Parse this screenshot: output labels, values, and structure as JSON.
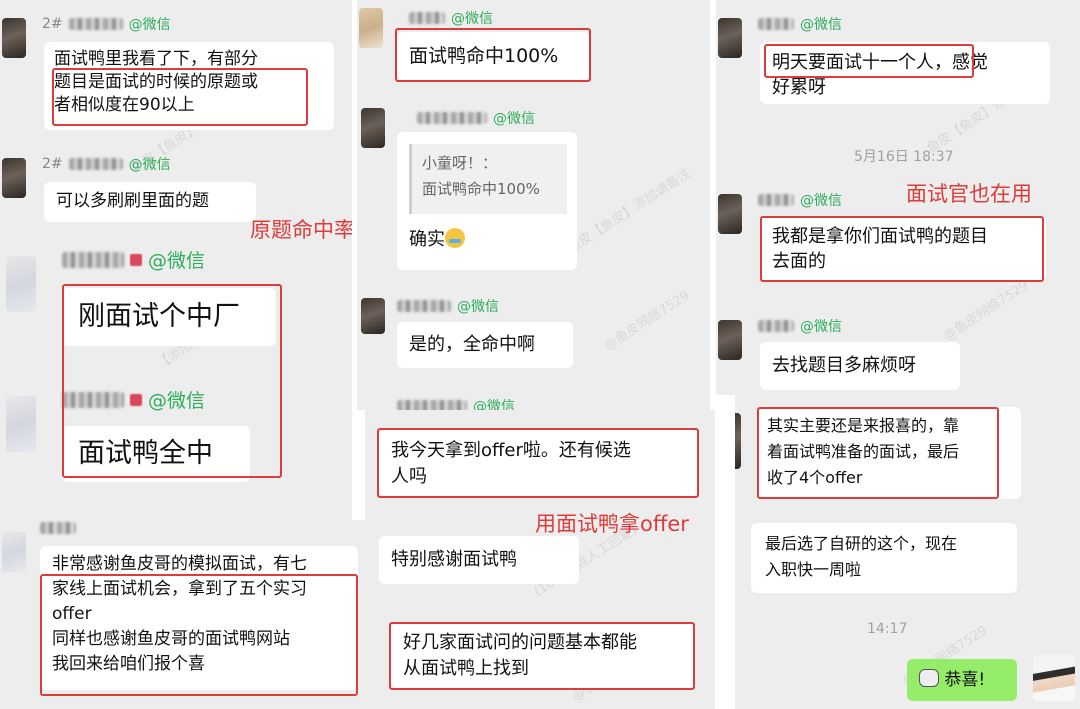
{
  "wechat": "@微信",
  "p1": {
    "name1_prefix": "2#",
    "name2_prefix": "2#",
    "msg1": [
      "面试鸭里我看了下，有部分",
      "题目是面试的时候的原题或",
      "者相似度在90以上"
    ],
    "msg2": "可以多刷刷里面的题",
    "annotation": "原题命中率高",
    "msg3": "刚面试个中厂",
    "msg4": "面试鸭全中"
  },
  "p2": {
    "msg1": "面试鸭命中100%",
    "quote_name": "小童呀！：",
    "quote_text": "面试鸭命中100%",
    "msg2": "确实",
    "msg3": "是的，全命中啊"
  },
  "p3": {
    "msg1": [
      "明天要面试十一个人，感觉",
      "好累呀"
    ],
    "time": "5月16日  18:37",
    "annotation": "面试官也在用",
    "msg2": [
      "我都是拿你们面试鸭的题目",
      "去面的"
    ],
    "msg3": "去找题目多麻烦呀"
  },
  "p4": {
    "msg1": [
      "非常感谢鱼皮哥的模拟面试，有七",
      "家线上面试机会，拿到了五个实习",
      "offer",
      "同样也感谢鱼皮哥的面试鸭网站",
      "我回来给咱们报个喜"
    ]
  },
  "p5": {
    "msg1": [
      "我今天拿到offer啦。还有候选",
      "人吗"
    ],
    "annotation": "用面试鸭拿offer",
    "msg2": "特别感谢面试鸭",
    "msg3": [
      "好几家面试问的问题基本都能",
      "从面试鸭上找到"
    ]
  },
  "p6": {
    "msg1": [
      "其实主要还是来报喜的，靠",
      "着面试鸭准备的面试，最后",
      "收了4个offer"
    ],
    "msg2": [
      "最后选了自研的这个，现在",
      "入职快一周啦"
    ],
    "time": "14:17",
    "msg3": "恭喜!"
  },
  "watermarks": [
    "鱼皮【鱼皮】添加请备注",
    "@鱼皮网络7529",
    "(10~19点人工回复)",
    "【添加请认真】"
  ]
}
